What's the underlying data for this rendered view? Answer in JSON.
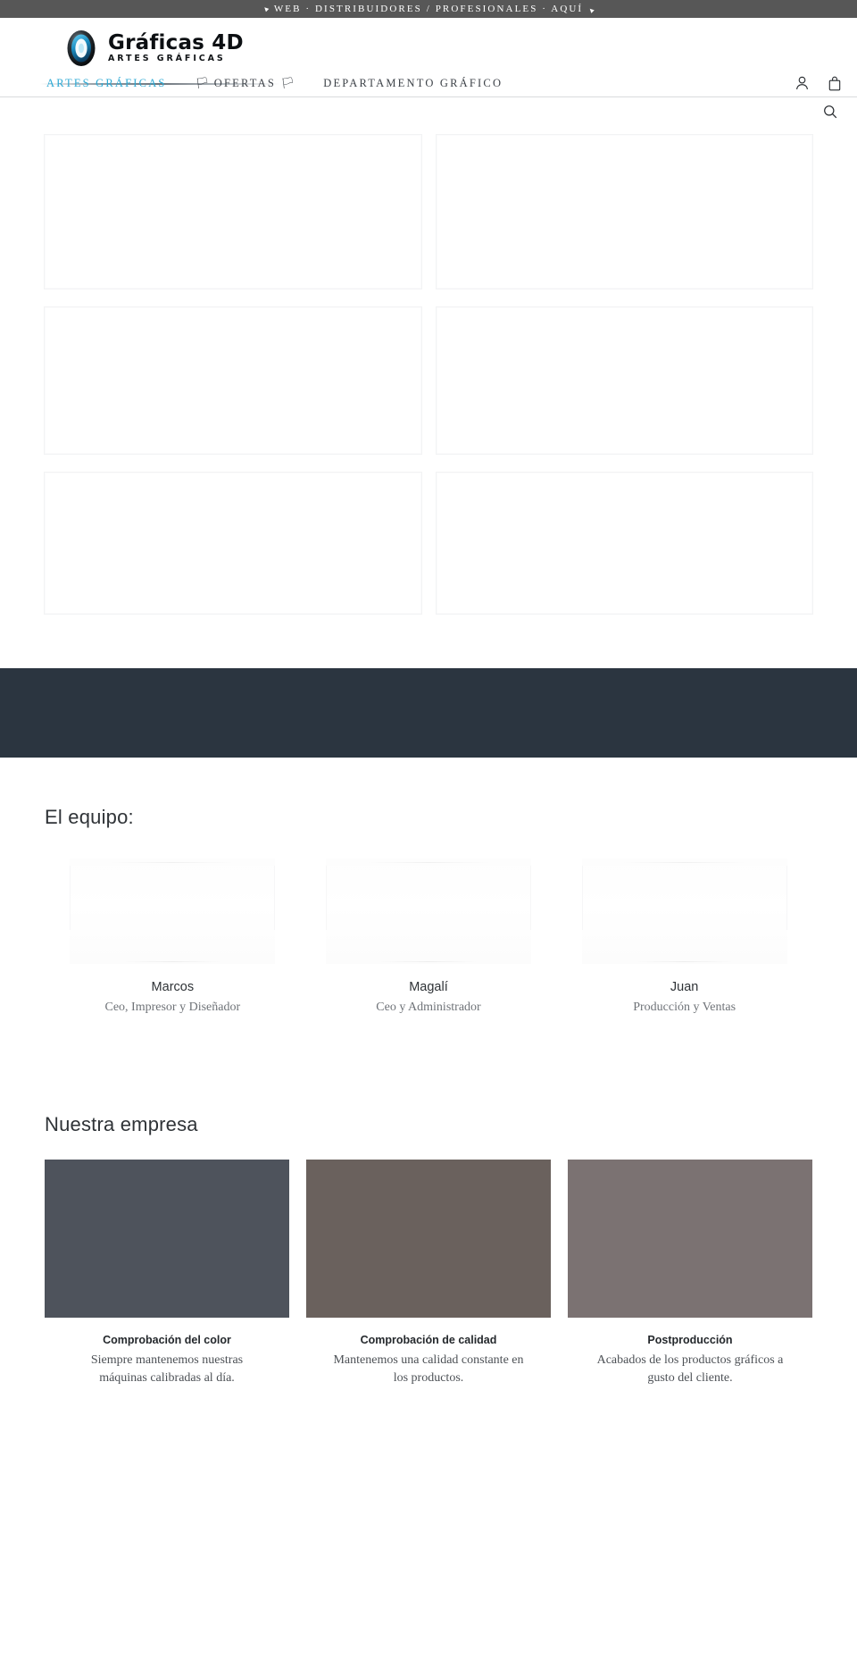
{
  "announcement": {
    "text": "WEB · DISTRIBUIDORES / PROFESIONALES · AQUÍ",
    "left_arrow": "◥",
    "right_arrow": "◢",
    "background": "#575757",
    "color": "#ffffff"
  },
  "brand": {
    "name": "Gráficas 4D",
    "tagline": "ARTES GRÁFICAS",
    "logo_icon": "graficas-4d-logo",
    "accent": "#2aa8d4"
  },
  "nav": {
    "items": [
      {
        "label": "ARTES GRÁFICAS",
        "active": true,
        "flag_left": "",
        "flag_right": ""
      },
      {
        "label": "OFERTAS",
        "active": false,
        "flag_left": "🏳",
        "flag_right": "🏳"
      },
      {
        "label": "DEPARTAMENTO GRÁFICO",
        "active": false,
        "flag_left": "",
        "flag_right": ""
      }
    ],
    "account_icon": "account-icon",
    "cart_icon": "shopping-bag-icon",
    "search_icon": "search-icon"
  },
  "product_grid": {
    "placeholders": [
      {
        "id": "product-placeholder-1"
      },
      {
        "id": "product-placeholder-2"
      },
      {
        "id": "product-placeholder-3"
      },
      {
        "id": "product-placeholder-4"
      },
      {
        "id": "product-placeholder-5"
      },
      {
        "id": "product-placeholder-6"
      }
    ]
  },
  "dark_band": {
    "background": "#2b3540"
  },
  "team": {
    "title": "El equipo:",
    "members": [
      {
        "name": "Marcos",
        "role": "Ceo, Impresor y Diseñador"
      },
      {
        "name": "Magalí",
        "role": "Ceo y Administrador"
      },
      {
        "name": "Juan",
        "role": "Producción y Ventas"
      }
    ]
  },
  "company": {
    "title": "Nuestra empresa",
    "cards": [
      {
        "title": "Comprobación del color",
        "text": "Siempre mantenemos nuestras máquinas calibradas al día.",
        "color": "#4e535c"
      },
      {
        "title": "Comprobación de calidad",
        "text": "Mantenemos una calidad constante en los productos.",
        "color": "#6a615d"
      },
      {
        "title": "Postproducción",
        "text": "Acabados de los productos gráficos a gusto del cliente.",
        "color": "#7b7272"
      }
    ]
  }
}
